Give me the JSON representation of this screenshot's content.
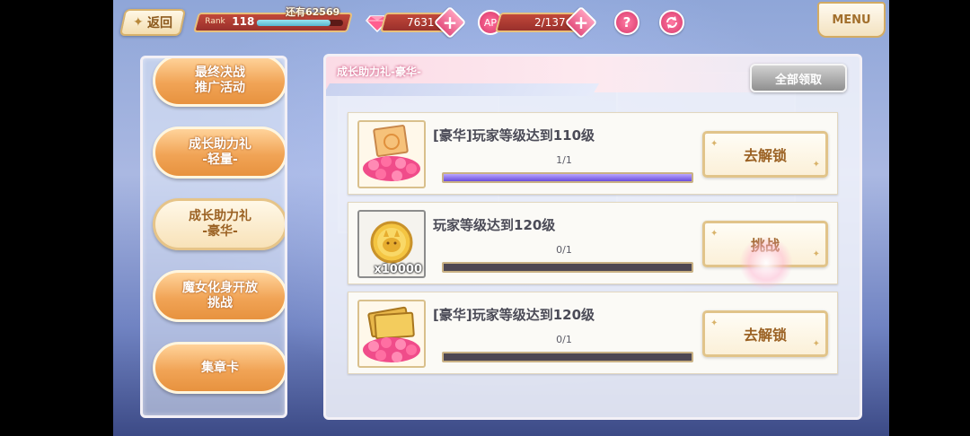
{
  "topbar": {
    "back_label": "返回",
    "rank_label": "Rank",
    "rank_value": "118",
    "rank_progress": 0.85,
    "remaining_label": "还有62569",
    "gems_value": "7631",
    "ap_badge": "AP",
    "ap_value": "2/137",
    "help_glyph": "?",
    "menu_label": "MENU"
  },
  "sidebar": {
    "items": [
      {
        "label": "最终决战\n推广活动",
        "active": false
      },
      {
        "label": "成长助力礼\n-轻量-",
        "active": false
      },
      {
        "label": "成长助力礼\n-豪华-",
        "active": true
      },
      {
        "label": "魔女化身开放\n挑战",
        "active": false
      },
      {
        "label": "集章卡",
        "active": false
      }
    ]
  },
  "main": {
    "title": "成长助力礼-豪华-",
    "claim_all_label": "全部领取",
    "rewards": [
      {
        "name": "[豪华]玩家等级达到110级",
        "progress_text": "1/1",
        "progress": 1.0,
        "button_label": "去解锁",
        "icon": "gold-card-gems-icon",
        "quantity": ""
      },
      {
        "name": "玩家等级达到120级",
        "progress_text": "0/1",
        "progress": 0.0,
        "button_label": "挑战",
        "icon": "gold-coin-icon",
        "quantity": "x10000"
      },
      {
        "name": "[豪华]玩家等级达到120级",
        "progress_text": "0/1",
        "progress": 0.0,
        "button_label": "去解锁",
        "icon": "gold-tickets-gems-icon",
        "quantity": ""
      }
    ]
  }
}
